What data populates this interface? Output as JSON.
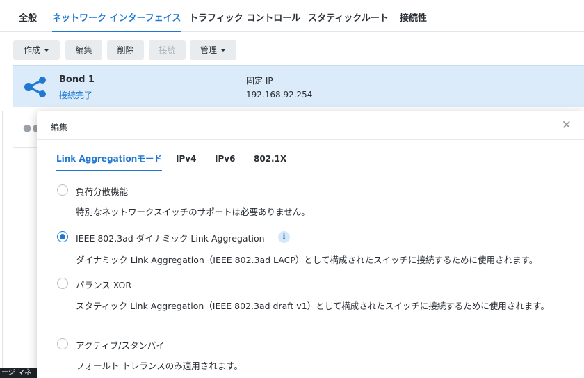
{
  "main_tabs": [
    "全般",
    "ネットワーク インターフェイス",
    "トラフィック コントロール",
    "スタティックルート",
    "接続性"
  ],
  "toolbar": {
    "create": "作成",
    "edit": "編集",
    "delete": "削除",
    "connect": "接続",
    "manage": "管理"
  },
  "interfaces": [
    {
      "name": "Bond 1",
      "status": "接続完了",
      "ip_type": "固定 IP",
      "ip": "192.168.92.254"
    }
  ],
  "dialog": {
    "title": "編集",
    "close_glyph": "✕",
    "tabs": [
      "Link Aggregationモード",
      "IPv4",
      "IPv6",
      "802.1X"
    ],
    "options": [
      {
        "label": "負荷分散機能",
        "description": "特別なネットワークスイッチのサポートは必要ありません。",
        "checked": false
      },
      {
        "label": "IEEE 802.3ad ダイナミック Link Aggregation",
        "description": "ダイナミック Link Aggregation（IEEE 802.3ad LACP）として構成されたスイッチに接続するために使用されます。",
        "checked": true
      },
      {
        "label": "バランス XOR",
        "description": "スタティック Link Aggregation（IEEE 802.3ad draft v1）として構成されたスイッチに接続するために使用されます。",
        "checked": false
      },
      {
        "label": "アクティブ/スタンバイ",
        "description": "フォールト トレランスのみ適用されます。",
        "checked": false
      }
    ],
    "info_glyph": "i"
  },
  "taskbar_label": "ージ マネ",
  "colors": {
    "accent": "#1f78d1",
    "selected_row": "#dcebf9"
  }
}
